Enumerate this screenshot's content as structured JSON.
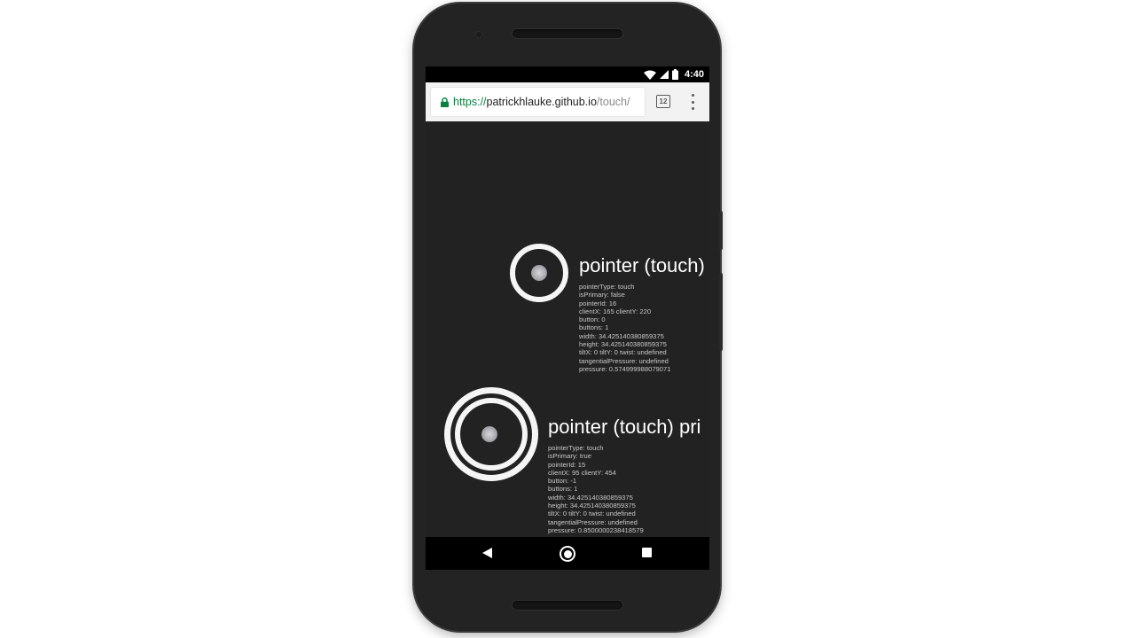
{
  "status_bar": {
    "time": "4:40",
    "icons": [
      "wifi-icon",
      "cellular-signal-icon",
      "battery-icon"
    ]
  },
  "browser": {
    "url": {
      "scheme": "https://",
      "host": "patrickhlauke.github.io",
      "path": "/touch/"
    },
    "tab_count": "12",
    "icons": [
      "lock-icon",
      "tab-switcher-icon",
      "overflow-menu-icon"
    ]
  },
  "pointers": [
    {
      "title": "pointer (touch)",
      "properties": [
        "pointerType: touch",
        "isPrimary: false",
        "pointerId: 16",
        "clientX: 165 clientY: 220",
        "button: 0",
        "buttons: 1",
        "width: 34.425140380859375",
        "height: 34.425140380859375",
        "tiltX: 0 tiltY: 0 twist: undefined",
        "tangentialPressure: undefined",
        "pressure: 0.574999988079071"
      ]
    },
    {
      "title": "pointer (touch) pri",
      "properties": [
        "pointerType: touch",
        "isPrimary: true",
        "pointerId: 15",
        "clientX: 95 clientY: 454",
        "button: -1",
        "buttons: 1",
        "width: 34.425140380859375",
        "height: 34.425140380859375",
        "tiltX: 0 tiltY: 0 twist: undefined",
        "tangentialPressure: undefined",
        "pressure: 0.8500000238418579"
      ]
    }
  ],
  "nav_bar": {
    "icons": [
      "back-icon",
      "home-icon",
      "recents-icon"
    ]
  },
  "colors": {
    "page_background": "#222222",
    "url_scheme": "#0b8043",
    "ring": "#f5f5f5"
  }
}
